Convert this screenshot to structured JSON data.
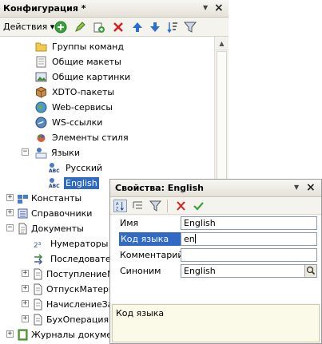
{
  "config": {
    "title": "Конфигурация *",
    "actions_label": "Действия",
    "tree": [
      {
        "label": "Группы команд",
        "icon": "folder-icon"
      },
      {
        "label": "Общие макеты",
        "icon": "layout-icon"
      },
      {
        "label": "Общие картинки",
        "icon": "picture-icon"
      },
      {
        "label": "XDTO-пакеты",
        "icon": "package-icon"
      },
      {
        "label": "Web-сервисы",
        "icon": "globe-icon"
      },
      {
        "label": "WS-ссылки",
        "icon": "globe-link-icon"
      },
      {
        "label": "Элементы стиля",
        "icon": "style-icon"
      },
      {
        "label": "Языки",
        "icon": "language-icon"
      },
      {
        "label": "Русский",
        "icon": "abc-icon"
      },
      {
        "label": "English",
        "icon": "abc-icon"
      },
      {
        "label": "Константы",
        "icon": "constants-icon"
      },
      {
        "label": "Справочники",
        "icon": "catalog-icon"
      },
      {
        "label": "Документы",
        "icon": "document-icon"
      },
      {
        "label": "Нумераторы",
        "icon": "numerator-icon"
      },
      {
        "label": "Последовател",
        "icon": "sequence-icon"
      },
      {
        "label": "ПоступлениеМ",
        "icon": "document-icon"
      },
      {
        "label": "ОтпускМатери",
        "icon": "document-icon"
      },
      {
        "label": "НачислениеЗа",
        "icon": "document-icon"
      },
      {
        "label": "БухОперация",
        "icon": "document-icon"
      },
      {
        "label": "Журналы докумен",
        "icon": "journal-icon"
      }
    ]
  },
  "props": {
    "title": "Свойства: English",
    "rows": [
      {
        "name": "Имя",
        "value": "English"
      },
      {
        "name": "Код языка",
        "value": "en"
      },
      {
        "name": "Комментарий",
        "value": ""
      },
      {
        "name": "Синоним",
        "value": "English"
      }
    ],
    "description": "Код языка"
  },
  "colors": {
    "selection": "#316ac5",
    "add_green": "#3aa23a",
    "delete_red": "#d42020",
    "arrow_blue": "#2c6fd1"
  }
}
